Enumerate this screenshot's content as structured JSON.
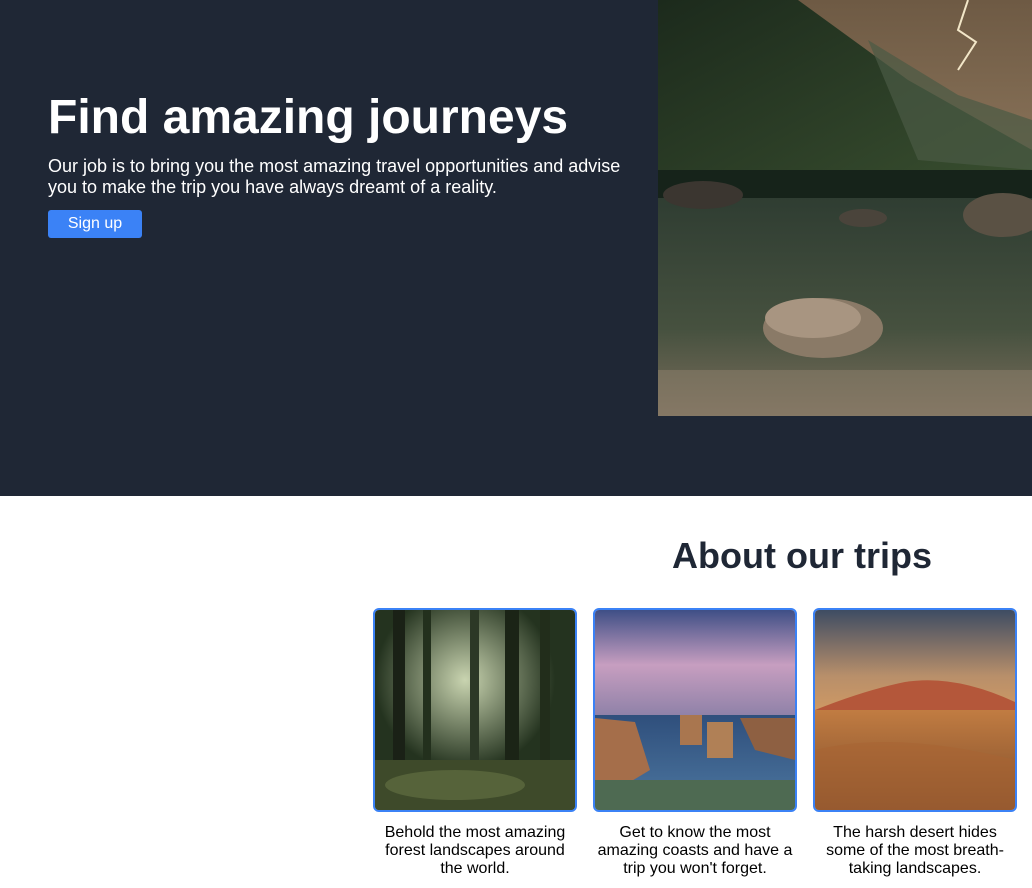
{
  "hero": {
    "title": "Find amazing journeys",
    "text": "Our job is to bring you the most amazing travel opportunities and advise you to make the trip you have always dreamt of a reality.",
    "signup_label": "Sign up"
  },
  "about": {
    "title": "About our trips",
    "trips": [
      {
        "caption": "Behold the most amazing forest landscapes around the world."
      },
      {
        "caption": "Get to know the most amazing coasts and have a trip you won't forget."
      },
      {
        "caption": "The harsh desert hides some of the most breath-taking landscapes."
      }
    ]
  },
  "colors": {
    "hero_bg": "#1f2735",
    "accent": "#3b82f6",
    "heading": "#1f2735"
  }
}
